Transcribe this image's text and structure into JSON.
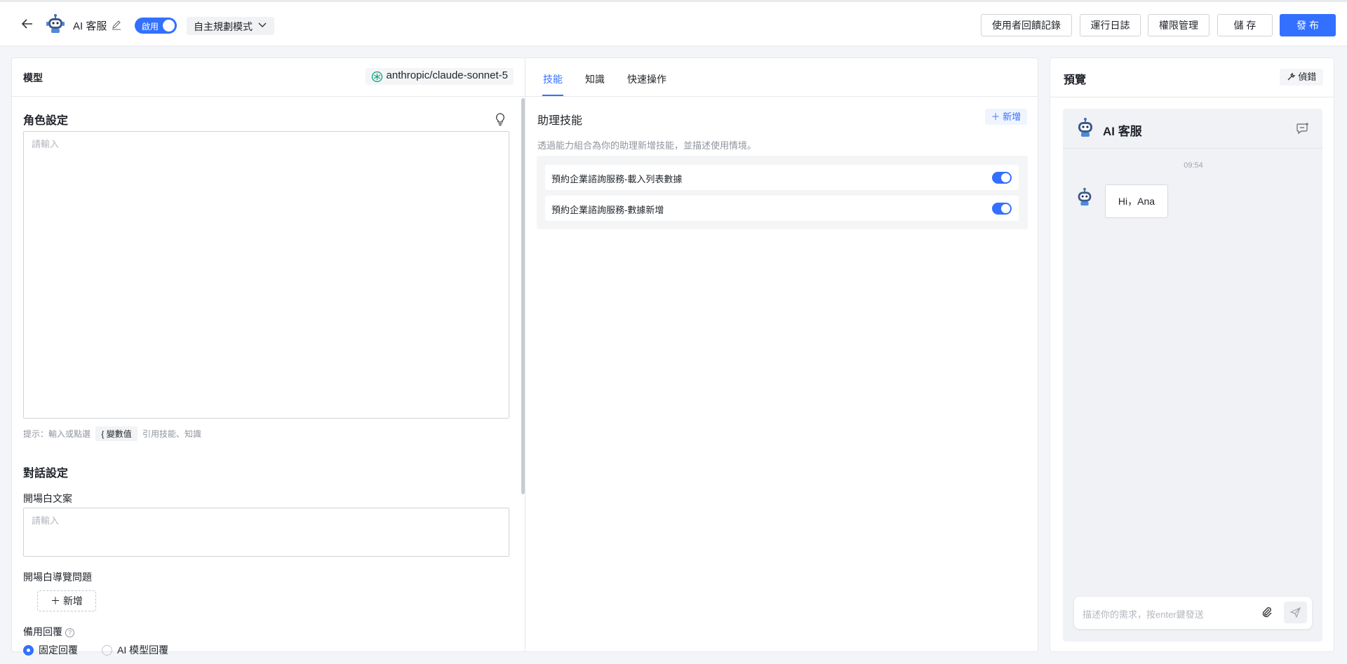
{
  "header": {
    "app_name": "AI 客服",
    "enable_label": "啟用",
    "mode": "自主規劃模式",
    "buttons": [
      "使用者回饋記錄",
      "運行日誌",
      "權限管理",
      "儲 存",
      "發 布"
    ]
  },
  "left": {
    "model_label": "模型",
    "model_value": "anthropic/claude-sonnet-5",
    "role_title": "角色設定",
    "role_placeholder": "請輸入",
    "hint_prefix": "提示：輸入或點選",
    "hint_chip": "{ 變數值",
    "hint_suffix": "引用技能、知識",
    "dialog_title": "對話設定",
    "opening_label": "開場白文案",
    "opening_placeholder": "請輸入",
    "guide_label": "開場白導覽問題",
    "add_label": "新增",
    "fallback_label": "備用回覆",
    "radio_fixed": "固定回覆",
    "radio_ai": "AI 模型回覆"
  },
  "middle": {
    "tabs": [
      "技能",
      "知識",
      "快速操作"
    ],
    "skills_title": "助理技能",
    "add_label": "新增",
    "skills_desc": "透過能力組合為你的助理新增技能，並描述使用情境。",
    "skills": [
      {
        "name": "預約企業諮詢服務-載入列表數據",
        "enabled": true
      },
      {
        "name": "預約企業諮詢服務-數據新增",
        "enabled": true
      }
    ]
  },
  "preview": {
    "title": "預覽",
    "debug_label": "偵錯",
    "bot_name": "AI 客服",
    "time": "09:54",
    "greeting": "Hi，Ana",
    "input_placeholder": "描述你的需求，按enter鍵發送"
  },
  "colors": {
    "accent": "#3370ff"
  }
}
